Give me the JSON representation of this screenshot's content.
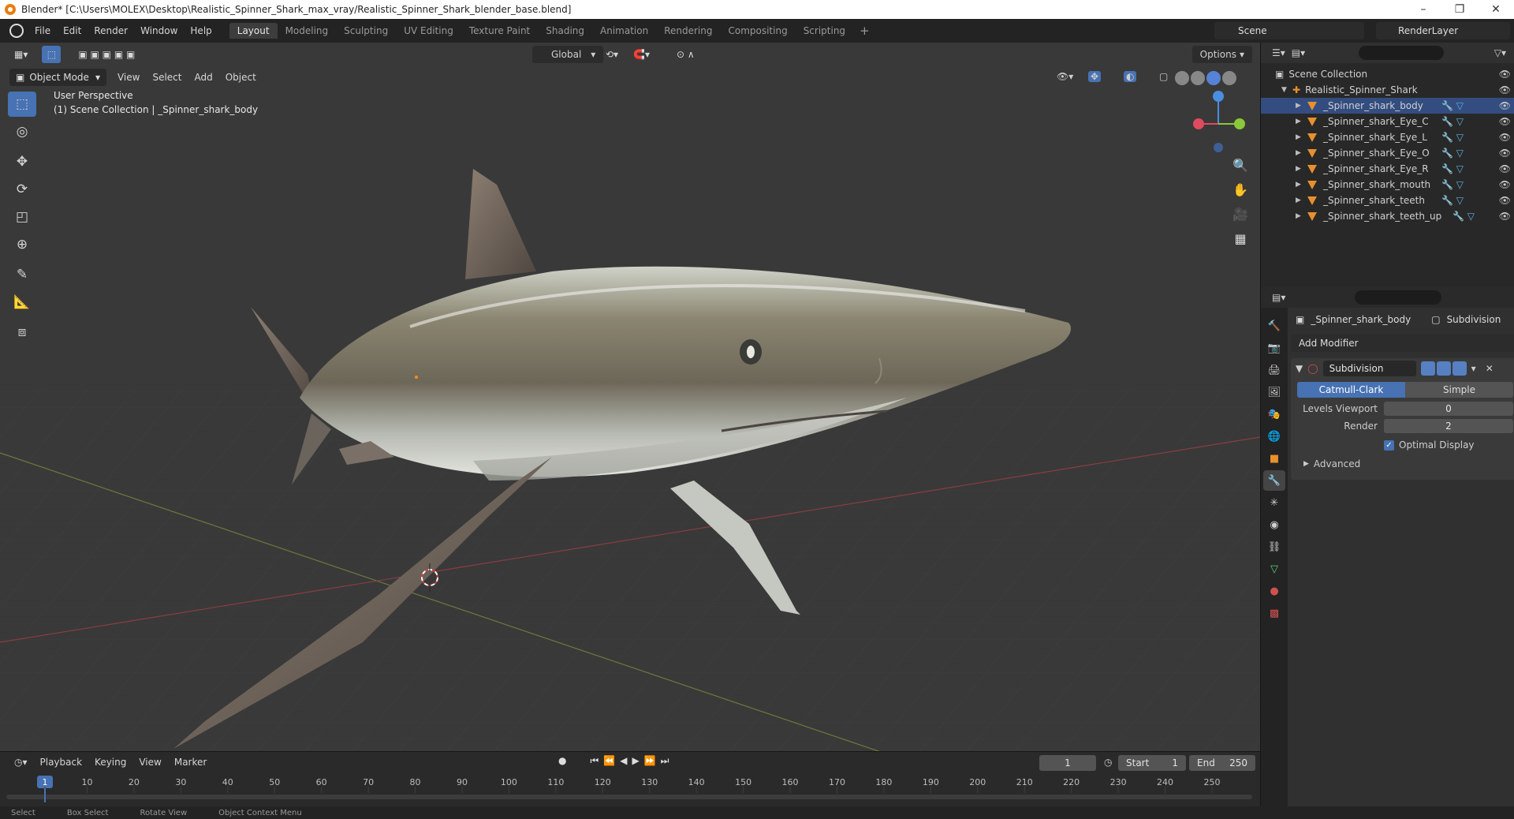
{
  "window": {
    "title": "Blender* [C:\\Users\\MOLEX\\Desktop\\Realistic_Spinner_Shark_max_vray/Realistic_Spinner_Shark_blender_base.blend]",
    "minimize": "–",
    "restore": "❐",
    "close": "✕"
  },
  "menu": [
    "File",
    "Edit",
    "Render",
    "Window",
    "Help"
  ],
  "workspaces": [
    "Layout",
    "Modeling",
    "Sculpting",
    "UV Editing",
    "Texture Paint",
    "Shading",
    "Animation",
    "Rendering",
    "Compositing",
    "Scripting"
  ],
  "workspace_add": "+",
  "scene": "Scene",
  "render_layer": "RenderLayer",
  "viewport": {
    "mode": "Object Mode",
    "menus": [
      "View",
      "Select",
      "Add",
      "Object"
    ],
    "orientation": "Global",
    "options": "Options",
    "perspective": "User Perspective",
    "collection_info": "(1) Scene Collection | _Spinner_shark_body",
    "tools": [
      "select-box-icon",
      "cursor-icon",
      "move-icon",
      "rotate-icon",
      "scale-icon",
      "transform-icon",
      "annotate-icon",
      "measure-icon",
      "add-cube-icon"
    ],
    "gizmo_axes": {
      "x": "#e04a5e",
      "y": "#8bc73a",
      "z": "#4a8ee0"
    }
  },
  "outliner": {
    "root": "Scene Collection",
    "collection": "Realistic_Spinner_Shark",
    "objects": [
      "_Spinner_shark_body",
      "_Spinner_shark_Eye_C",
      "_Spinner_shark_Eye_L",
      "_Spinner_shark_Eye_O",
      "_Spinner_shark_Eye_R",
      "_Spinner_shark_mouth",
      "_Spinner_shark_teeth",
      "_Spinner_shark_teeth_up"
    ]
  },
  "properties": {
    "object": "_Spinner_shark_body",
    "modifier_crumb": "Subdivision",
    "add_modifier": "Add Modifier",
    "modifier": {
      "name": "Subdivision",
      "type_options": [
        "Catmull-Clark",
        "Simple"
      ],
      "levels_viewport_label": "Levels Viewport",
      "levels_viewport": "0",
      "render_label": "Render",
      "render": "2",
      "optimal_display": "Optimal Display",
      "advanced": "Advanced"
    }
  },
  "timeline": {
    "menus": [
      "Playback",
      "Keying",
      "View",
      "Marker"
    ],
    "current_frame": "1",
    "start_label": "Start",
    "start": "1",
    "end_label": "End",
    "end": "250",
    "ticks": [
      "1",
      "10",
      "20",
      "30",
      "40",
      "50",
      "60",
      "70",
      "80",
      "90",
      "100",
      "110",
      "120",
      "130",
      "140",
      "150",
      "160",
      "170",
      "180",
      "190",
      "200",
      "210",
      "220",
      "230",
      "240",
      "250"
    ]
  },
  "statusbar": [
    "Select",
    "Box Select",
    "Rotate View",
    "Object Context Menu"
  ]
}
